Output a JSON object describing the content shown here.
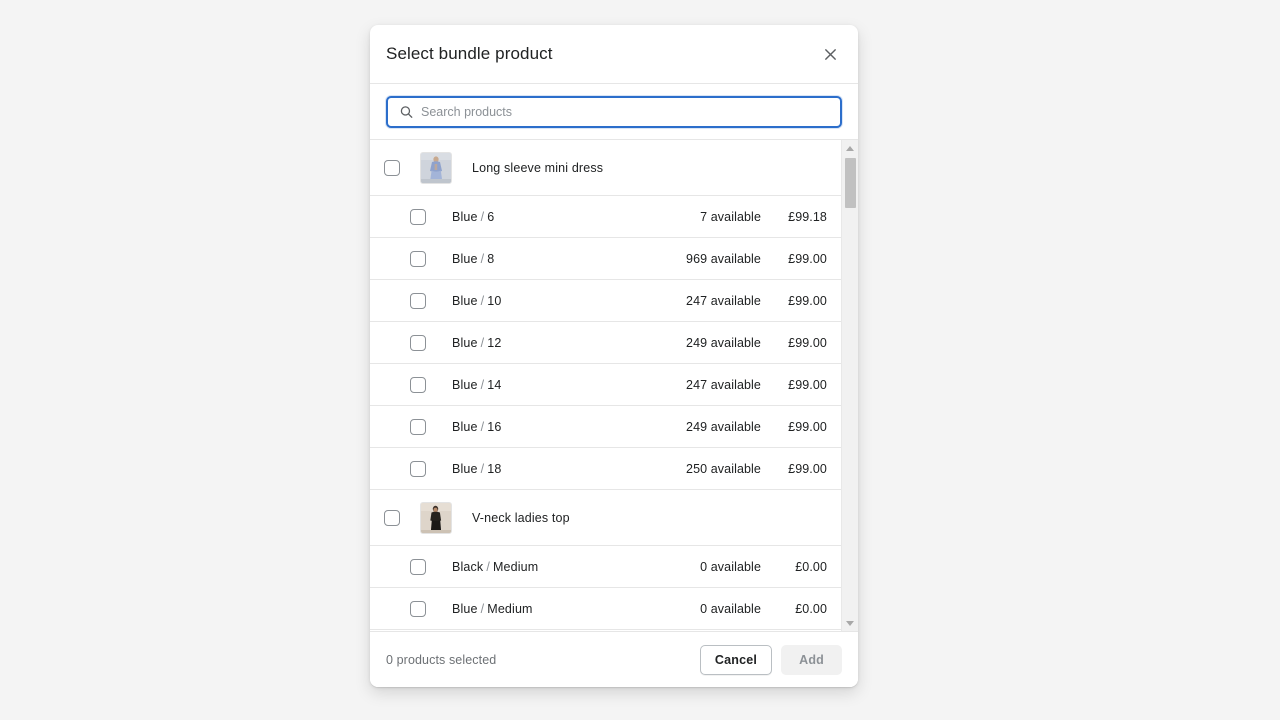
{
  "modal": {
    "title": "Select bundle product",
    "close_icon": "close-icon"
  },
  "search": {
    "icon": "search-icon",
    "placeholder": "Search products",
    "value": ""
  },
  "list": {
    "products": [
      {
        "name": "Long sleeve mini dress",
        "thumbnail": "blue-dress-thumbnail",
        "selected": false,
        "variants": [
          {
            "option1": "Blue",
            "separator": "/",
            "option2": "6",
            "availability": "7 available",
            "price": "£99.18",
            "selected": false
          },
          {
            "option1": "Blue",
            "separator": "/",
            "option2": "8",
            "availability": "969 available",
            "price": "£99.00",
            "selected": false
          },
          {
            "option1": "Blue",
            "separator": "/",
            "option2": "10",
            "availability": "247 available",
            "price": "£99.00",
            "selected": false
          },
          {
            "option1": "Blue",
            "separator": "/",
            "option2": "12",
            "availability": "249 available",
            "price": "£99.00",
            "selected": false
          },
          {
            "option1": "Blue",
            "separator": "/",
            "option2": "14",
            "availability": "247 available",
            "price": "£99.00",
            "selected": false
          },
          {
            "option1": "Blue",
            "separator": "/",
            "option2": "16",
            "availability": "249 available",
            "price": "£99.00",
            "selected": false
          },
          {
            "option1": "Blue",
            "separator": "/",
            "option2": "18",
            "availability": "250 available",
            "price": "£99.00",
            "selected": false
          }
        ]
      },
      {
        "name": "V-neck ladies top",
        "thumbnail": "black-top-thumbnail",
        "selected": false,
        "variants": [
          {
            "option1": "Black",
            "separator": "/",
            "option2": "Medium",
            "availability": "0 available",
            "price": "£0.00",
            "selected": false
          },
          {
            "option1": "Blue",
            "separator": "/",
            "option2": "Medium",
            "availability": "0 available",
            "price": "£0.00",
            "selected": false
          }
        ]
      }
    ]
  },
  "footer": {
    "status": "0 products selected",
    "cancel_label": "Cancel",
    "add_label": "Add",
    "add_disabled": true
  },
  "colors": {
    "accent": "#2c6ecb",
    "text": "#202223",
    "muted": "#6d7175",
    "border": "#e6e6e6",
    "page_background": "#f4f4f4",
    "scrollbar_track": "#f1f1f1",
    "scrollbar_thumb": "#c1c1c1"
  }
}
